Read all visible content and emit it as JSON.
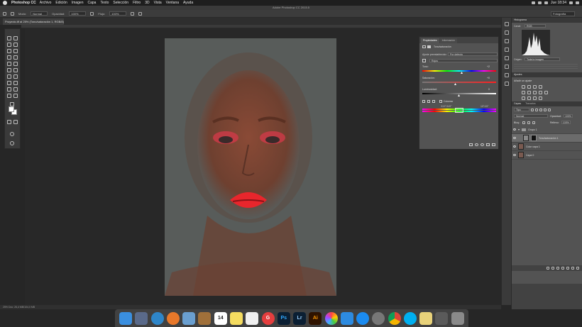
{
  "menubar": {
    "app": "Photoshop CC",
    "items": [
      "Archivo",
      "Edición",
      "Imagen",
      "Capa",
      "Texto",
      "Selección",
      "Filtro",
      "3D",
      "Vista",
      "Ventana",
      "Ayuda"
    ],
    "clock": "Jue 18:34"
  },
  "window_title": "Adobe Photoshop CC 2015.5",
  "options": {
    "mode_label": "Modo:",
    "mode_value": "Normal",
    "opacity_label": "Opacidad:",
    "opacity_value": "100%",
    "flow_label": "Flujo:",
    "flow_value": "100%",
    "workspace": "Fotografía"
  },
  "document": {
    "tab_title": "Proyecto.tif al 25% (Tono/saturación 1, RGB/8)",
    "status": "25%     Doc: 26,4 MB/104,0 MB"
  },
  "properties": {
    "tabs": [
      "Propiedades",
      "Información"
    ],
    "adjustment": "Tono/saturación",
    "preset_label": "Ajuste preestablecido:",
    "preset_value": "Por defecto",
    "channel": "Rojos",
    "hue_label": "Tono:",
    "hue_value": "+2",
    "sat_label": "Saturación:",
    "sat_value": "+0",
    "light_label": "Luminosidad:",
    "light_value": "0",
    "colorize_label": "Colorear",
    "range_left": "315°/345°",
    "range_right": "15°/45°"
  },
  "histogram": {
    "title": "Histograma",
    "channel_label": "Canal:",
    "channel_value": "RGB",
    "source_label": "Origen:",
    "source_value": "Toda la imagen"
  },
  "adjustments": {
    "title": "Ajustes",
    "subtitle": "Añadir un ajuste"
  },
  "layers": {
    "tabs": [
      "Capas",
      "Trazados"
    ],
    "kind": "Tipo",
    "blend": "Normal",
    "opacity_label": "Opacidad:",
    "opacity_value": "100%",
    "fill_label": "Relleno:",
    "fill_value": "100%",
    "lock_label": "Bloq.:",
    "items": [
      {
        "name": "Grupo 1",
        "kind": "group"
      },
      {
        "name": "Tono/saturación 1",
        "kind": "adjustment"
      },
      {
        "name": "Color capa 1",
        "kind": "pixel"
      },
      {
        "name": "Capa 0",
        "kind": "pixel"
      }
    ]
  },
  "dock_apps": [
    "finder",
    "launchpad",
    "safari",
    "firefox",
    "preview",
    "notes",
    "calendar",
    "stickies",
    "textedit",
    "grammarly",
    "photoshop",
    "lightroom",
    "illustrator",
    "photos",
    "xcode",
    "app-store",
    "settings",
    "chrome",
    "skype",
    "finder-folder",
    "downloads",
    "trash"
  ],
  "dock_labels": {
    "calendar": "14",
    "photoshop": "Ps",
    "lightroom": "Lr",
    "illustrator": "Ai",
    "grammarly": "G"
  },
  "colors": {
    "accent_red": "#e8262c",
    "skin": "#7a4a3a",
    "bg": "#585c5a"
  }
}
